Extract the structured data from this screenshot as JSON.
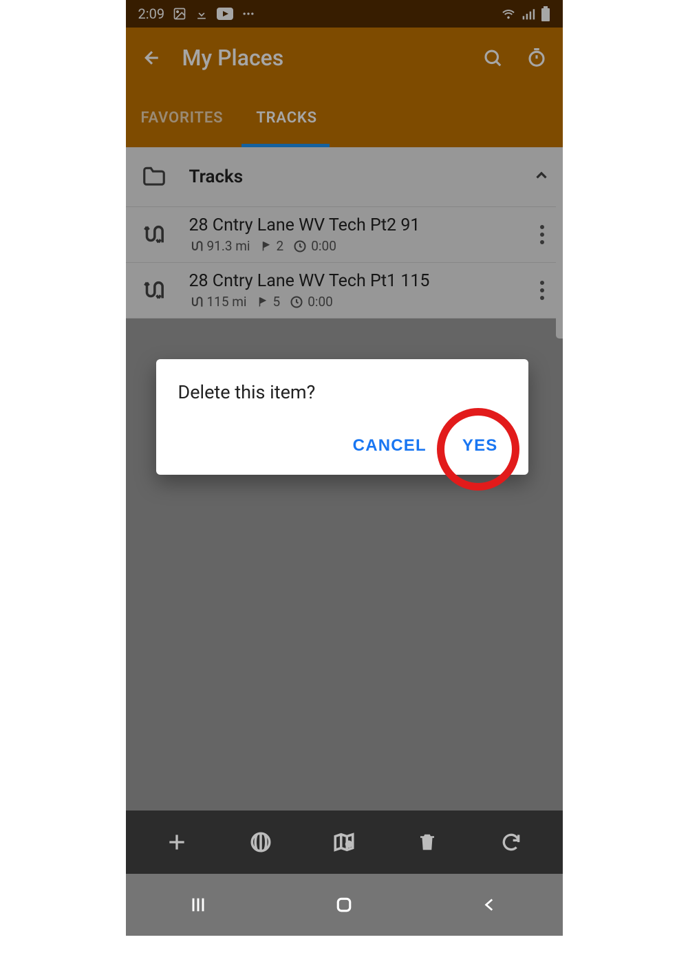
{
  "status_bar": {
    "time": "2:09"
  },
  "app_bar": {
    "title": "My Places"
  },
  "tabs": {
    "favorites": "FAVORITES",
    "tracks": "TRACKS"
  },
  "folder": {
    "title": "Tracks"
  },
  "tracks": [
    {
      "title": "28 Cntry Lane WV Tech Pt2 91",
      "distance": "91.3 mi",
      "waypoints": "2",
      "duration": "0:00"
    },
    {
      "title": "28 Cntry Lane WV Tech Pt1 115",
      "distance": "115 mi",
      "waypoints": "5",
      "duration": "0:00"
    }
  ],
  "dialog": {
    "title": "Delete this item?",
    "cancel": "CANCEL",
    "confirm": "YES"
  }
}
